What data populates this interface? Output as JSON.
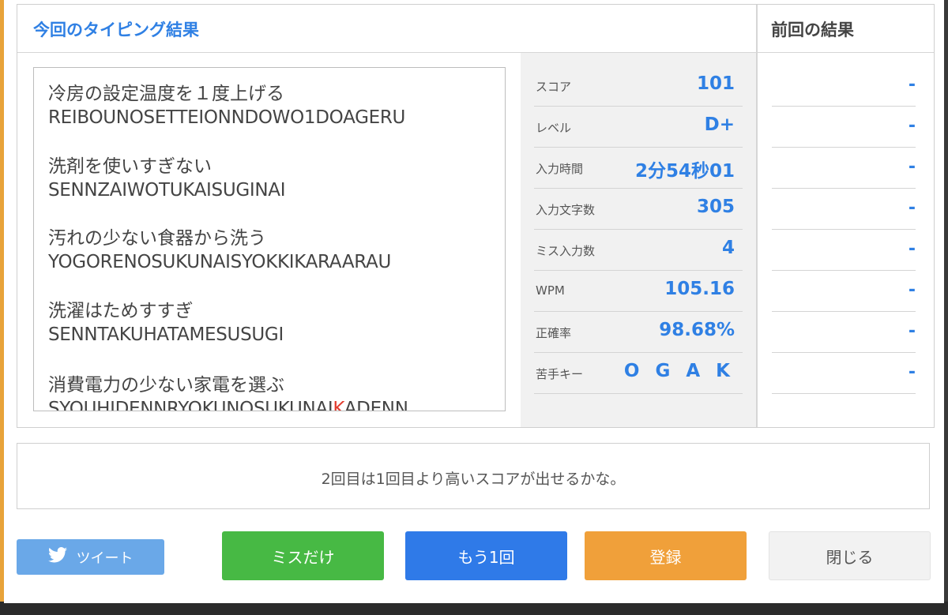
{
  "header": {
    "current_title": "今回のタイピング結果",
    "previous_title": "前回の結果"
  },
  "phrases": [
    {
      "jp": "冷房の設定温度を１度上げる",
      "romaji": "REIBOUNOSETTEIONNDOWO1DOAGERU"
    },
    {
      "jp": "洗剤を使いすぎない",
      "romaji": "SENNZAIWOTUKAISUGINAI"
    },
    {
      "jp": "汚れの少ない食器から洗う",
      "romaji": "YOGORENOSUKUNAISYOKKIKARAARAU"
    },
    {
      "jp": "洗濯はためすすぎ",
      "romaji": "SENNTAKUHATAMESUSUGI"
    },
    {
      "jp": "消費電力の少ない家電を選ぶ",
      "romaji_before": "SYOUHIDENNRYOKUNOSUKUNAI",
      "romaji_miss": "K",
      "romaji_after": "ADENN"
    }
  ],
  "stats": [
    {
      "label": "スコア",
      "value": "101"
    },
    {
      "label": "レベル",
      "value": "D+"
    },
    {
      "label": "入力時間",
      "value": "2分54秒01"
    },
    {
      "label": "入力文字数",
      "value": "305"
    },
    {
      "label": "ミス入力数",
      "value": "4"
    },
    {
      "label": "WPM",
      "value": "105.16"
    },
    {
      "label": "正確率",
      "value": "98.68%"
    },
    {
      "label": "苦手キー",
      "value": "O G A K"
    }
  ],
  "previous": [
    "-",
    "-",
    "-",
    "-",
    "-",
    "-",
    "-",
    "-"
  ],
  "message": "2回目は1回目より高いスコアが出せるかな。",
  "buttons": {
    "tweet": "ツイート",
    "miss_only": "ミスだけ",
    "again": "もう1回",
    "register": "登録",
    "close": "閉じる"
  },
  "icons": {
    "tweet": "twitter-bird-icon"
  },
  "colors": {
    "accent_blue": "#2f80e4",
    "miss_red": "#e23b2e",
    "btn_green": "#47b944",
    "btn_blue": "#2f7ae8",
    "btn_orange": "#f0a03a",
    "btn_tweet": "#6aa8e8"
  }
}
